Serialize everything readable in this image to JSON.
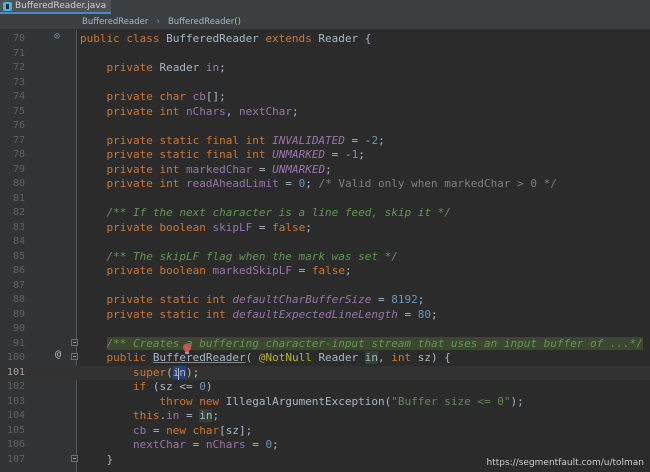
{
  "tab": {
    "label": "BufferedReader.java"
  },
  "breadcrumb": {
    "class_name": "BufferedReader",
    "method_name": "BufferedReader()"
  },
  "gutter": {
    "override_marker": "⊙",
    "annotation_marker": "@"
  },
  "watermark": "https://segmentfault.com/u/tolman",
  "code_lines": [
    {
      "n": "70",
      "s": [
        [
          "kw",
          "public class "
        ],
        [
          "",
          "BufferedReader "
        ],
        [
          "kw",
          "extends "
        ],
        [
          "",
          "Reader {"
        ]
      ]
    },
    {
      "n": "71",
      "s": []
    },
    {
      "n": "72",
      "s": [
        [
          "",
          "    "
        ],
        [
          "kw",
          "private "
        ],
        [
          "",
          "Reader "
        ],
        [
          "fld",
          "in"
        ],
        [
          "",
          ";"
        ]
      ]
    },
    {
      "n": "73",
      "s": []
    },
    {
      "n": "74",
      "s": [
        [
          "",
          "    "
        ],
        [
          "kw",
          "private char "
        ],
        [
          "fld",
          "cb"
        ],
        [
          "",
          "[];"
        ]
      ]
    },
    {
      "n": "75",
      "s": [
        [
          "",
          "    "
        ],
        [
          "kw",
          "private int "
        ],
        [
          "fld",
          "nChars"
        ],
        [
          "",
          ", "
        ],
        [
          "fld",
          "nextChar"
        ],
        [
          "",
          ";"
        ]
      ]
    },
    {
      "n": "76",
      "s": []
    },
    {
      "n": "77",
      "s": [
        [
          "",
          "    "
        ],
        [
          "kw",
          "private static final int "
        ],
        [
          "sfld",
          "INVALIDATED"
        ],
        [
          "",
          " = -"
        ],
        [
          "num",
          "2"
        ],
        [
          "",
          ";"
        ]
      ]
    },
    {
      "n": "78",
      "s": [
        [
          "",
          "    "
        ],
        [
          "kw",
          "private static final int "
        ],
        [
          "sfld",
          "UNMARKED"
        ],
        [
          "",
          " = -"
        ],
        [
          "num",
          "1"
        ],
        [
          "",
          ";"
        ]
      ]
    },
    {
      "n": "79",
      "s": [
        [
          "",
          "    "
        ],
        [
          "kw",
          "private int "
        ],
        [
          "fld",
          "markedChar"
        ],
        [
          "",
          " = "
        ],
        [
          "sfld",
          "UNMARKED"
        ],
        [
          "",
          ";"
        ]
      ]
    },
    {
      "n": "80",
      "s": [
        [
          "",
          "    "
        ],
        [
          "kw",
          "private int "
        ],
        [
          "fld",
          "readAheadLimit"
        ],
        [
          "",
          " = "
        ],
        [
          "num",
          "0"
        ],
        [
          "",
          "; "
        ],
        [
          "cm",
          "/* Valid only when markedChar > 0 */"
        ]
      ]
    },
    {
      "n": "81",
      "s": []
    },
    {
      "n": "82",
      "s": [
        [
          "",
          "    "
        ],
        [
          "doc",
          "/** If the next character is a line feed, skip it */"
        ]
      ]
    },
    {
      "n": "83",
      "s": [
        [
          "",
          "    "
        ],
        [
          "kw",
          "private boolean "
        ],
        [
          "fld",
          "skipLF"
        ],
        [
          "",
          " = "
        ],
        [
          "kw",
          "false"
        ],
        [
          "",
          ";"
        ]
      ]
    },
    {
      "n": "84",
      "s": []
    },
    {
      "n": "85",
      "s": [
        [
          "",
          "    "
        ],
        [
          "doc",
          "/** The skipLF flag when the mark was set */"
        ]
      ]
    },
    {
      "n": "86",
      "s": [
        [
          "",
          "    "
        ],
        [
          "kw",
          "private boolean "
        ],
        [
          "fld",
          "markedSkipLF"
        ],
        [
          "",
          " = "
        ],
        [
          "kw",
          "false"
        ],
        [
          "",
          ";"
        ]
      ]
    },
    {
      "n": "87",
      "s": []
    },
    {
      "n": "88",
      "s": [
        [
          "",
          "    "
        ],
        [
          "kw",
          "private static int "
        ],
        [
          "sfld",
          "defaultCharBufferSize"
        ],
        [
          "",
          " = "
        ],
        [
          "num",
          "8192"
        ],
        [
          "",
          ";"
        ]
      ]
    },
    {
      "n": "89",
      "s": [
        [
          "",
          "    "
        ],
        [
          "kw",
          "private static int "
        ],
        [
          "sfld",
          "defaultExpectedLineLength"
        ],
        [
          "",
          " = "
        ],
        [
          "num",
          "80"
        ],
        [
          "",
          ";"
        ]
      ]
    },
    {
      "n": "90",
      "s": []
    },
    {
      "n": "91",
      "s": [
        [
          "",
          "    "
        ],
        [
          "doc docbg",
          "/** Creates a buffering character-input stream that uses an input buffer of ...*/"
        ]
      ]
    },
    {
      "n": "100",
      "s": [
        [
          "",
          "    "
        ],
        [
          "kw",
          "public "
        ],
        [
          "under",
          "BufferedReader"
        ],
        [
          "",
          "( "
        ],
        [
          "ann",
          "@NotNull "
        ],
        [
          "",
          "Reader "
        ],
        [
          "hl2",
          "in"
        ],
        [
          "",
          ", "
        ],
        [
          "kw",
          "int "
        ],
        [
          "",
          "sz) {"
        ]
      ]
    },
    {
      "n": "101",
      "s": [
        [
          "",
          "        "
        ],
        [
          "kw",
          "super"
        ],
        [
          "",
          "("
        ],
        [
          "hl",
          "in"
        ],
        [
          "",
          ");"
        ]
      ]
    },
    {
      "n": "102",
      "s": [
        [
          "",
          "        "
        ],
        [
          "kw",
          "if "
        ],
        [
          "",
          "(sz <= "
        ],
        [
          "num",
          "0"
        ],
        [
          "",
          ")"
        ]
      ]
    },
    {
      "n": "103",
      "s": [
        [
          "",
          "            "
        ],
        [
          "kw",
          "throw new "
        ],
        [
          "",
          "IllegalArgumentException("
        ],
        [
          "str",
          "\"Buffer size <= 0\""
        ],
        [
          "",
          ");"
        ]
      ]
    },
    {
      "n": "104",
      "s": [
        [
          "",
          "        "
        ],
        [
          "kw",
          "this"
        ],
        [
          "",
          "."
        ],
        [
          "fld",
          "in "
        ],
        [
          "",
          "= "
        ],
        [
          "hl2",
          "in"
        ],
        [
          "",
          ";"
        ]
      ]
    },
    {
      "n": "105",
      "s": [
        [
          "",
          "        "
        ],
        [
          "fld",
          "cb "
        ],
        [
          "",
          "= "
        ],
        [
          "kw",
          "new char"
        ],
        [
          "",
          "[sz];"
        ]
      ]
    },
    {
      "n": "106",
      "s": [
        [
          "",
          "        "
        ],
        [
          "fld",
          "nextChar "
        ],
        [
          "",
          "= "
        ],
        [
          "fld",
          "nChars "
        ],
        [
          "",
          "= "
        ],
        [
          "num",
          "0"
        ],
        [
          "",
          ";"
        ]
      ]
    },
    {
      "n": "107",
      "s": [
        [
          "",
          "    }"
        ]
      ]
    }
  ]
}
